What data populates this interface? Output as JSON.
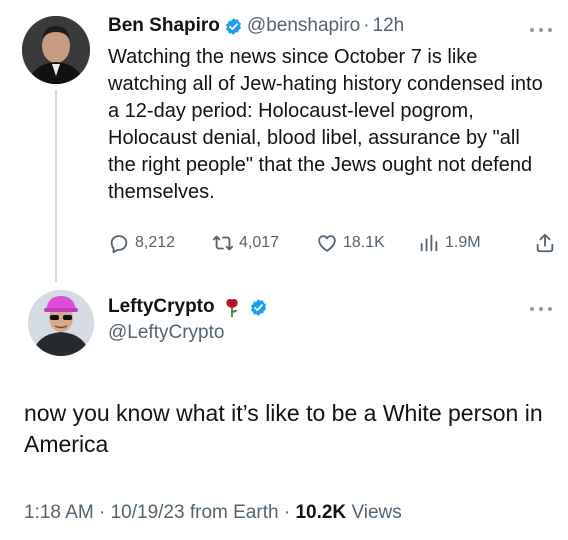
{
  "tweet1": {
    "author_name": "Ben Shapiro",
    "handle": "@benshapiro",
    "separator": "·",
    "time": "12h",
    "text": "Watching the news since October 7 is like watching all of Jew-hating history condensed into a 12-day period: Holocaust-level pogrom, Holocaust denial, blood libel, assurance by \"all the right people\" that the Jews ought not defend themselves.",
    "replies": "8,212",
    "reposts": "4,017",
    "likes": "18.1K",
    "views": "1.9M"
  },
  "tweet2": {
    "author_name": "LeftyCrypto",
    "handle": "@LeftyCrypto",
    "text": "now you know what it’s like to be a White person in America",
    "time": "1:18 AM",
    "date": "10/19/23",
    "source": "from Earth",
    "views_count": "10.2K",
    "views_label": "Views"
  },
  "icons": [
    "verified-badge-icon",
    "more-icon",
    "reply-icon",
    "repost-icon",
    "like-icon",
    "views-icon",
    "share-icon",
    "rose-icon"
  ],
  "colors": {
    "text": "#0f1419",
    "secondary": "#536471",
    "verified": "#1d9bf0",
    "thread_line": "#cfd9de"
  }
}
